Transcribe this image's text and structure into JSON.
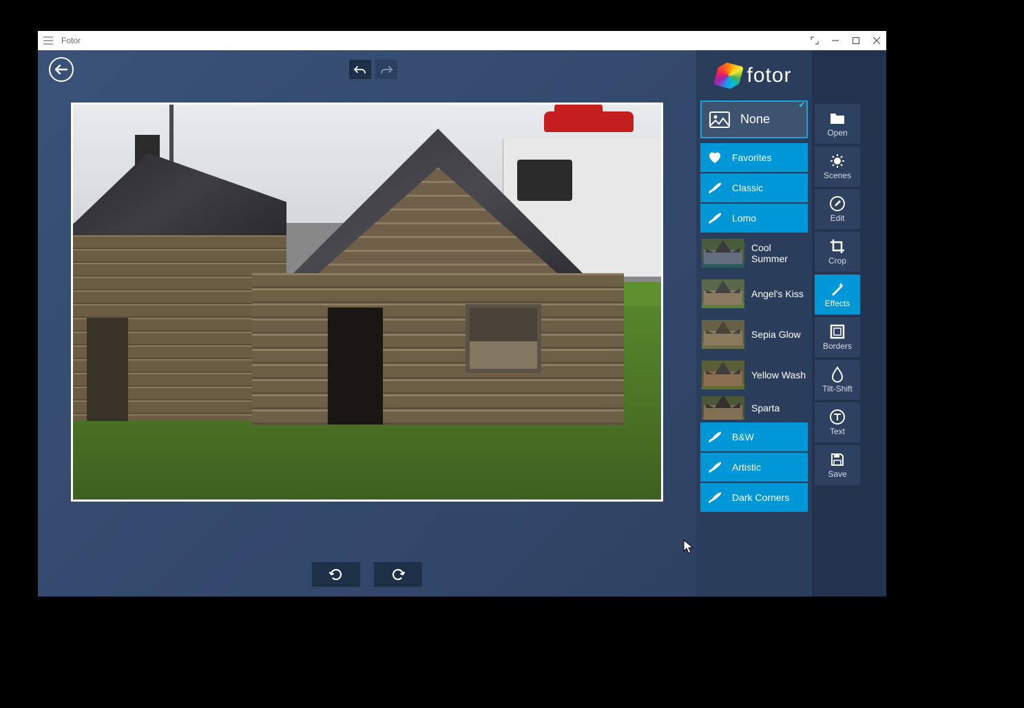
{
  "titlebar": {
    "app_name": "Fotor"
  },
  "logo": {
    "text": "fotor"
  },
  "effects": {
    "none_label": "None",
    "categories": {
      "favorites": "Favorites",
      "classic": "Classic",
      "lomo": "Lomo",
      "bw": "B&W",
      "artistic": "Artistic",
      "dark_corners": "Dark Corners"
    },
    "presets": {
      "cool_summer": "Cool Summer",
      "angels_kiss": "Angel's Kiss",
      "sepia_glow": "Sepia Glow",
      "yellow_wash": "Yellow Wash",
      "sparta": "Sparta"
    }
  },
  "tools": {
    "open": "Open",
    "scenes": "Scenes",
    "edit": "Edit",
    "crop": "Crop",
    "effects": "Effects",
    "borders": "Borders",
    "tilt_shift": "Tilt-Shift",
    "text": "Text",
    "save": "Save"
  }
}
